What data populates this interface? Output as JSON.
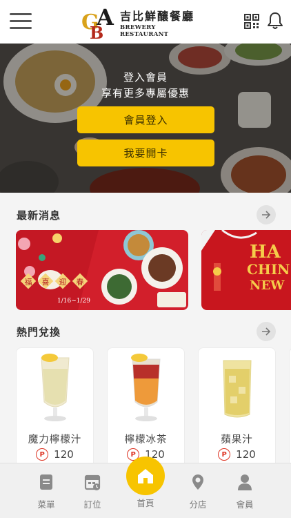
{
  "header": {
    "logo_cn": "吉比鮮釀餐廳",
    "logo_en": "BREWERY RESTAURANT",
    "logo_letters": "GBA",
    "menu_icon": "hamburger-menu-icon",
    "qr_icon": "qr-code-icon",
    "bell_icon": "notification-bell-icon"
  },
  "hero": {
    "title": "登入會員",
    "subtitle": "享有更多專屬優惠",
    "login_label": "會員登入",
    "open_card_label": "我要開卡"
  },
  "news": {
    "title": "最新消息",
    "cards": [
      {
        "badge_chars": [
          "福",
          "喜",
          "迎",
          "春"
        ],
        "date_range": "1/16~1/29"
      },
      {
        "text_line1": "HA",
        "text_line2": "CHIN",
        "text_line3": "NEW"
      }
    ]
  },
  "hot": {
    "title": "熱門兌換",
    "products": [
      {
        "name": "魔力檸檬汁",
        "points": "120",
        "point_symbol": "P"
      },
      {
        "name": "檸檬冰茶",
        "points": "120",
        "point_symbol": "P"
      },
      {
        "name": "蘋果汁",
        "points": "120",
        "point_symbol": "P"
      }
    ]
  },
  "nav": {
    "items": [
      {
        "label": "菜單",
        "icon": "menu-book-icon"
      },
      {
        "label": "訂位",
        "icon": "calendar-booking-icon"
      },
      {
        "label": "首頁",
        "icon": "home-icon"
      },
      {
        "label": "分店",
        "icon": "location-pin-icon"
      },
      {
        "label": "會員",
        "icon": "member-person-icon"
      }
    ]
  },
  "colors": {
    "accent": "#f7c400",
    "news_red": "#d21f2b",
    "text_dark": "#333333"
  }
}
